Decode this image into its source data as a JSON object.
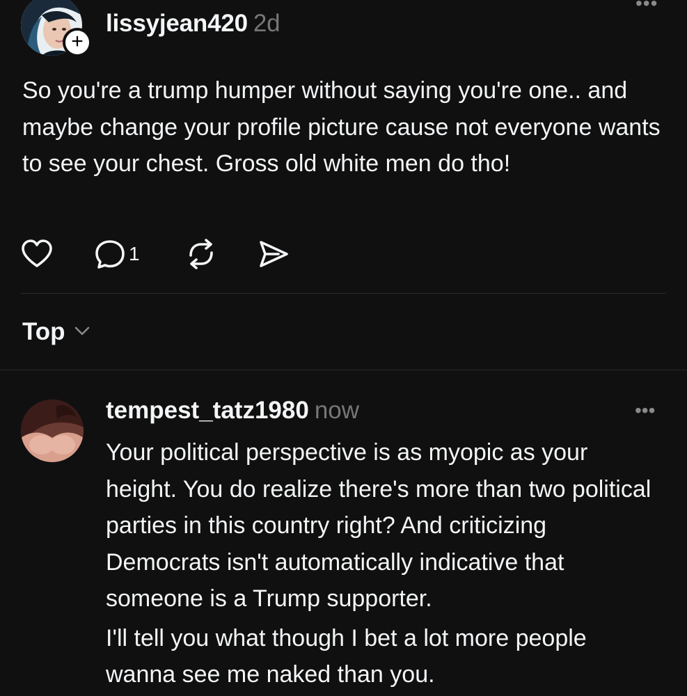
{
  "post": {
    "username": "lissyjean420",
    "time": "2d",
    "follow_badge": "+",
    "more_icon": "•••",
    "text": "So you're a trump humper without saying you're one.. and maybe change your profile picture cause not everyone wants to see your chest. Gross old white men do tho!",
    "actions": {
      "like_icon": "heart-icon",
      "comment_icon": "comment-icon",
      "comment_count": "1",
      "repost_icon": "repost-icon",
      "share_icon": "send-icon"
    }
  },
  "sort": {
    "label": "Top",
    "icon": "chevron-down-icon"
  },
  "reply": {
    "username": "tempest_tatz1980",
    "time": "now",
    "more_icon": "•••",
    "paragraphs": [
      "Your political perspective is as myopic as your height. You do realize there's more than two political parties in this country right? And criticizing Democrats isn't automatically indicative that someone is a Trump supporter.",
      "I'll tell you what though I bet a lot more people wanna see me naked than you."
    ]
  },
  "colors": {
    "background": "#101010",
    "text": "#f3f5f7",
    "muted": "#777777",
    "divider": "#2a2a2a"
  }
}
